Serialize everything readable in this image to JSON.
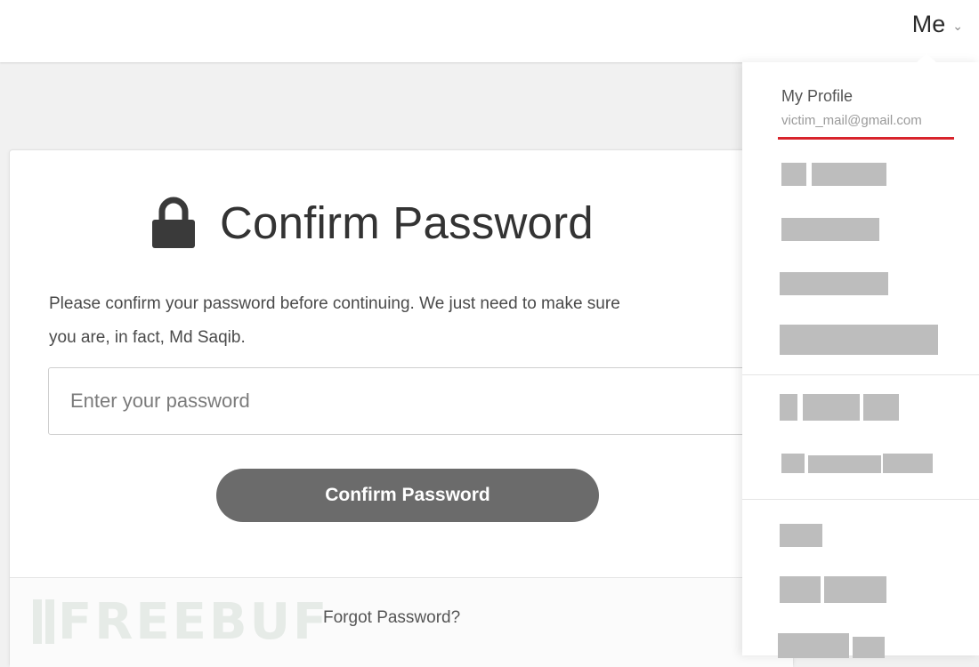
{
  "header": {
    "account_menu_label": "Me"
  },
  "confirm_dialog": {
    "title": "Confirm Password",
    "message_line1": "Please confirm your password before continuing. We just need to make sure",
    "message_line2": "you are, in fact, Md Saqib.",
    "password_placeholder": "Enter your password",
    "password_value": "",
    "confirm_button_label": "Confirm Password",
    "forgot_link_label": "Forgot Password?",
    "watermark": "FREEBUF"
  },
  "account_dropdown": {
    "profile_label": "My Profile",
    "profile_email": "victim_mail@gmail.com",
    "redacted_item_count": 9
  },
  "colors": {
    "button": "#6b6b6b",
    "highlight_underline": "#d8242c",
    "redaction": "#bdbdbd"
  },
  "icons": [
    "lock-icon",
    "chevron-down-icon"
  ]
}
